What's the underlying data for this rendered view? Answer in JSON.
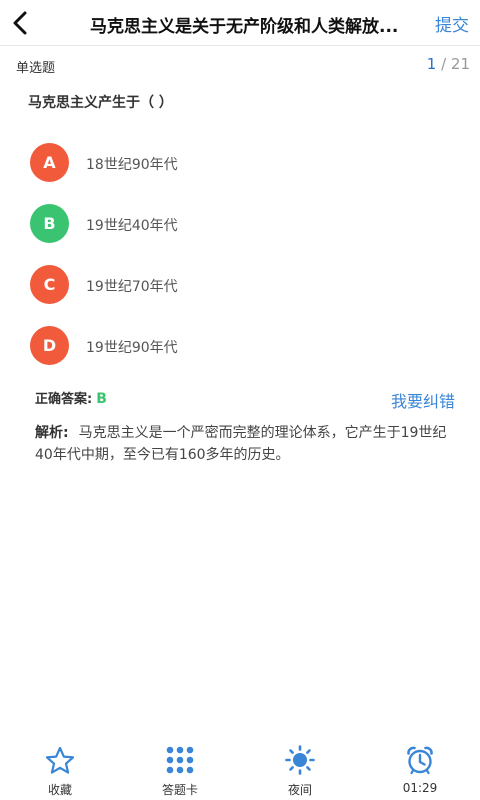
{
  "header": {
    "title": "马克思主义是关于无产阶级和人类解放...",
    "submit_label": "提交"
  },
  "meta": {
    "question_type": "单选题",
    "current": "1",
    "separator": " / ",
    "total": "21"
  },
  "question": {
    "text": "马克思主义产生于（  ）"
  },
  "options": [
    {
      "letter": "A",
      "text": "18世纪90年代",
      "color": "#f25a3c"
    },
    {
      "letter": "B",
      "text": "19世纪40年代",
      "color": "#3ac471"
    },
    {
      "letter": "C",
      "text": "19世纪70年代",
      "color": "#f25a3c"
    },
    {
      "letter": "D",
      "text": "19世纪90年代",
      "color": "#f25a3c"
    }
  ],
  "answer": {
    "label": "正确答案:",
    "value": "B",
    "report_label": "我要纠错"
  },
  "analysis": {
    "label": "解析:",
    "text": "马克思主义是一个严密而完整的理论体系，它产生于19世纪40年代中期，至今已有160多年的历史。"
  },
  "bottom_bar": {
    "tabs": [
      {
        "icon": "star-icon",
        "label": "收藏"
      },
      {
        "icon": "grid-icon",
        "label": "答题卡"
      },
      {
        "icon": "sun-icon",
        "label": "夜间"
      },
      {
        "icon": "alarm-clock-icon",
        "label": "01:29"
      }
    ]
  },
  "colors": {
    "accent": "#3a86d6",
    "wrong": "#f25a3c",
    "correct": "#3ac471"
  }
}
